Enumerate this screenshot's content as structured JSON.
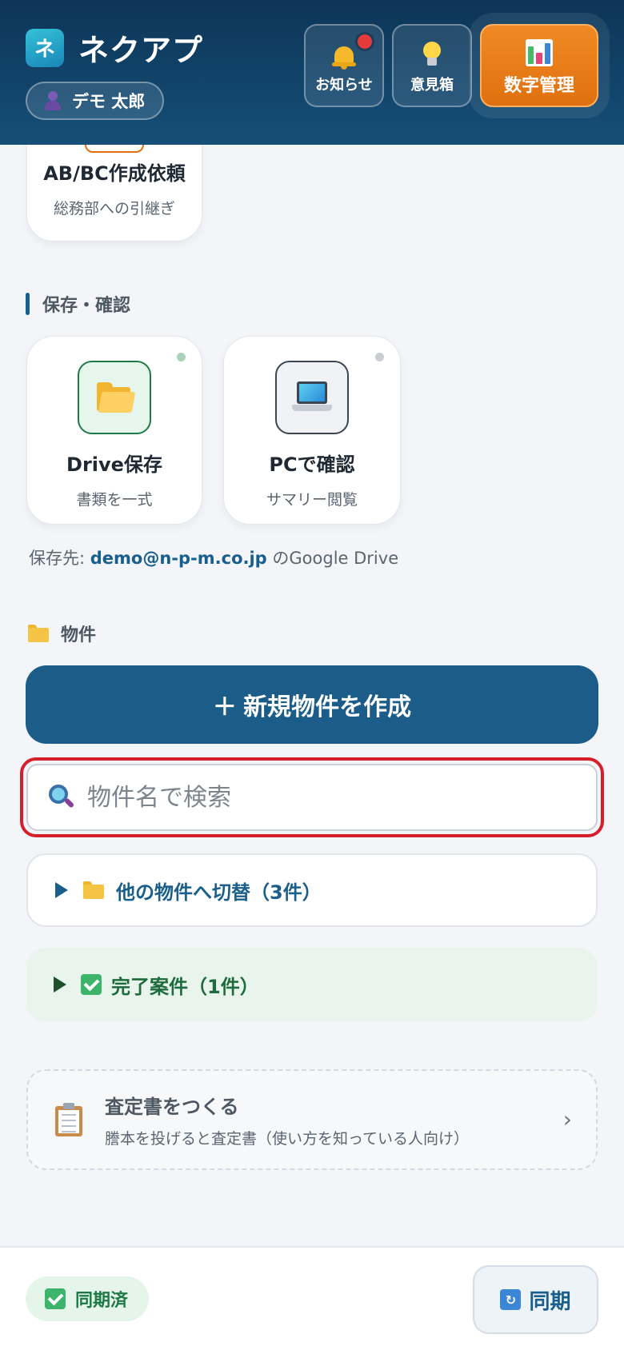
{
  "header": {
    "logo_char": "ネ",
    "app_title": "ネクアプ",
    "user_name": "デモ 太郎",
    "buttons": {
      "notice": "お知らせ",
      "idea_box": "意見箱",
      "numbers": "数字管理"
    }
  },
  "cards": {
    "abbc": {
      "title": "AB/BC作成依頼",
      "subtitle": "総務部への引継ぎ"
    },
    "drive": {
      "title": "Drive保存",
      "subtitle": "書類を一式"
    },
    "pc": {
      "title": "PCで確認",
      "subtitle": "サマリー閲覧"
    }
  },
  "sections": {
    "save_confirm": "保存・確認",
    "properties": "物件"
  },
  "save_destination": {
    "prefix": "保存先: ",
    "email": "demo@n-p-m.co.jp",
    "suffix": " のGoogle Drive"
  },
  "properties": {
    "create_button": "＋ 新規物件を作成",
    "search_placeholder": "物件名で検索",
    "switch_label": "他の物件へ切替（3件）",
    "done_label": "完了案件（1件）"
  },
  "assessment": {
    "title": "査定書をつくる",
    "description": "謄本を投げると査定書（使い方を知っている人向け）",
    "chevron": "›"
  },
  "footer": {
    "synced_label": "同期済",
    "sync_button": "同期",
    "sync_icon": "↻"
  },
  "colors": {
    "header_bg": "#0d3557",
    "primary": "#1b5c88",
    "accent_orange": "#e0700f",
    "search_highlight": "#d51f2a",
    "success_green": "#1e7a46"
  },
  "icons": [
    "bell-icon",
    "lightbulb-icon",
    "bar-chart-icon",
    "person-icon",
    "folder-icon",
    "laptop-icon",
    "search-icon",
    "triangle-right-icon",
    "checkbox-icon",
    "clipboard-icon",
    "chevron-right-icon",
    "sync-icon"
  ]
}
